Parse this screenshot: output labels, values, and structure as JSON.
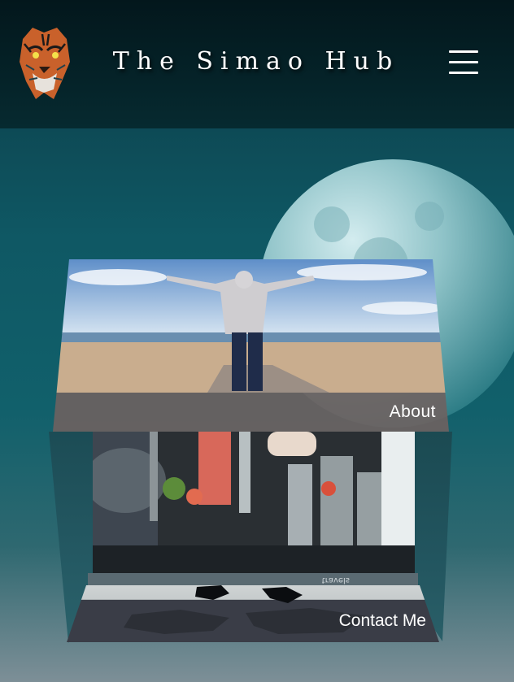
{
  "header": {
    "title": "The Simao Hub",
    "logo_icon": "tiger-logo-icon",
    "menu_icon": "hamburger-menu-icon",
    "background_color": "#03171c"
  },
  "background": {
    "icon": "moon-icon",
    "accent_color": "#11606b"
  },
  "cube": {
    "top_face": {
      "label": "About",
      "image": "person-arms-raised-beach-photo"
    },
    "inner_face": {
      "image": "drinks-bar-photo",
      "mirrored_text": "travels"
    },
    "bottom_face": {
      "label": "Contact Me",
      "image": "world-map-photo"
    }
  }
}
